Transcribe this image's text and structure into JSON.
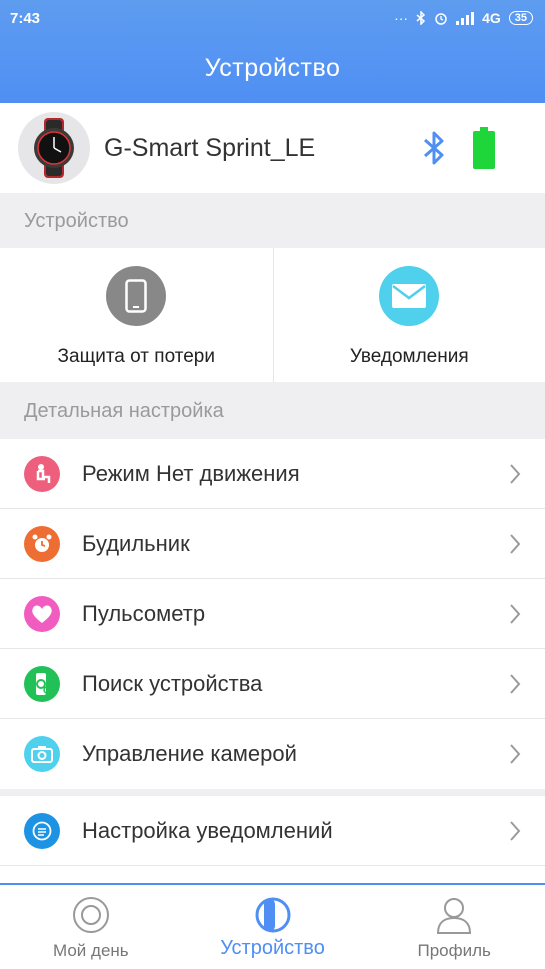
{
  "status_bar": {
    "time": "7:43",
    "network": "4G",
    "battery": "35"
  },
  "header": {
    "title": "Устройство"
  },
  "device": {
    "name": "G-Smart Sprint_LE",
    "avatar_icon": "watch-icon",
    "bluetooth_icon": "bluetooth-icon",
    "battery_icon": "battery-icon"
  },
  "sections": {
    "device_label": "Устройство",
    "detail_label": "Детальная настройка"
  },
  "quick_actions": [
    {
      "label": "Защита от потери",
      "icon": "phone-icon",
      "color": "#888888"
    },
    {
      "label": "Уведомления",
      "icon": "envelope-icon",
      "color": "#4fd0ec"
    }
  ],
  "settings_list": [
    {
      "label": "Режим Нет движения",
      "icon": "sitting-person-icon",
      "color": "#ee5f7d"
    },
    {
      "label": "Будильник",
      "icon": "alarm-clock-icon",
      "color": "#ee6d33"
    },
    {
      "label": "Пульсометр",
      "icon": "heart-icon",
      "color": "#f05cc0"
    },
    {
      "label": "Поиск устройства",
      "icon": "find-device-icon",
      "color": "#21c157"
    },
    {
      "label": "Управление камерой",
      "icon": "camera-icon",
      "color": "#4fd0ec"
    }
  ],
  "settings_list_2": [
    {
      "label": "Настройка уведомлений",
      "icon": "message-icon",
      "color": "#1d93e4"
    }
  ],
  "tabs": [
    {
      "label": "Мой день",
      "icon": "target-icon"
    },
    {
      "label": "Устройство",
      "icon": "device-icon"
    },
    {
      "label": "Профиль",
      "icon": "profile-icon"
    }
  ],
  "colors": {
    "accent": "#4f8ff3",
    "battery_green": "#1fd63a",
    "bluetooth_blue": "#4f8ff3"
  }
}
